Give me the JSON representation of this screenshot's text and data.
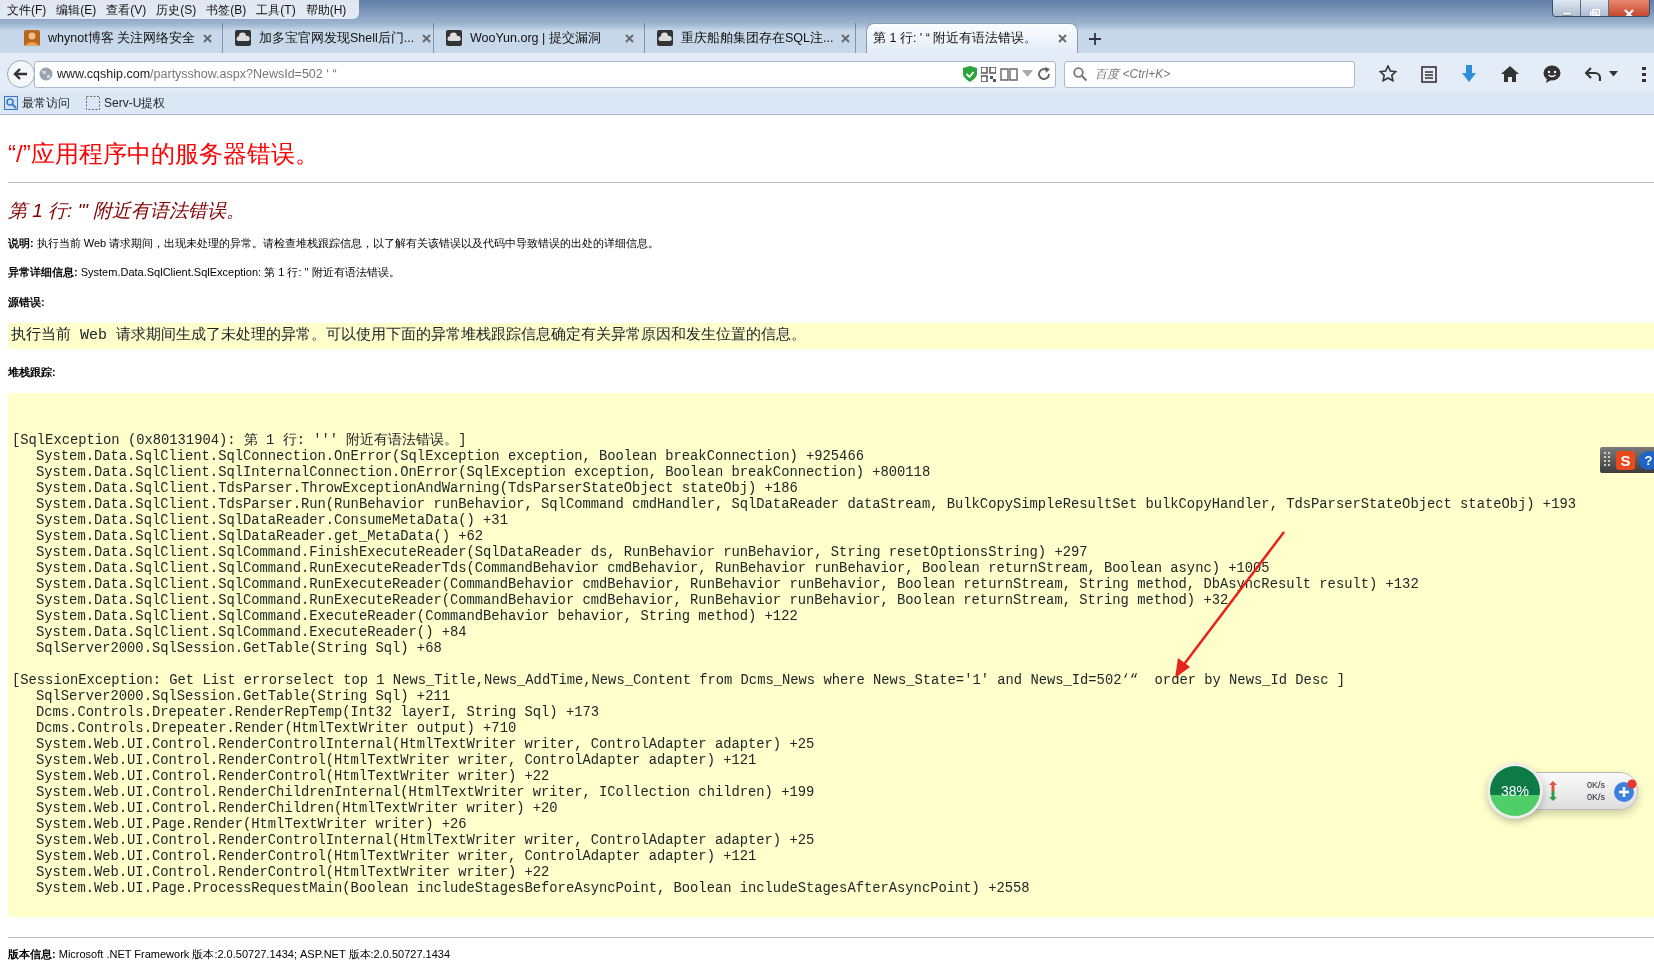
{
  "menu": [
    "文件(F)",
    "编辑(E)",
    "查看(V)",
    "历史(S)",
    "书签(B)",
    "工具(T)",
    "帮助(H)"
  ],
  "tabs": [
    {
      "label": "whynot博客 关注网络安全",
      "kind": "avatar",
      "selected": false
    },
    {
      "label": "加多宝官网发现Shell后门...",
      "kind": "cloud",
      "selected": false
    },
    {
      "label": "WooYun.org | 提交漏洞",
      "kind": "cloud",
      "selected": false
    },
    {
      "label": "重庆船舶集团存在SQL注...",
      "kind": "cloud",
      "selected": false
    },
    {
      "label": "第 1 行: '  “ 附近有语法错误。",
      "kind": "none",
      "selected": true
    }
  ],
  "address": {
    "host": "www.cqship.com",
    "path": "/partysshow.aspx?NewsId=502 ‘ “"
  },
  "search": {
    "placeholder": "百度 <Ctrl+K>"
  },
  "bookmarks": [
    {
      "label": "最常访问",
      "kind": "history"
    },
    {
      "label": "Serv-U提权",
      "kind": "blank"
    }
  ],
  "page": {
    "title": "“/”应用程序中的服务器错误。",
    "subtitle": "第 1 行: \"' 附近有语法错误。",
    "description": "**说明:** 执行当前 Web 请求期间，出现未处理的异常。请检查堆栈跟踪信息，以了解有关该错误以及代码中导致错误的出处的详细信息。",
    "exception_details": "**异常详细信息:** System.Data.SqlClient.SqlException: 第 1 行: '' 附近有语法错误。",
    "source_error_label": "源错误:",
    "source_error_text": "执行当前 Web 请求期间生成了未处理的异常。可以使用下面的异常堆栈跟踪信息确定有关异常原因和发生位置的信息。",
    "stack_trace_label": "堆栈跟踪:",
    "stack_trace": [
      {
        "kind": "header",
        "text": "[SqlException (0x80131904): 第 1 行: ''' 附近有语法错误。]"
      },
      {
        "kind": "frame",
        "text": "System.Data.SqlClient.SqlConnection.OnError(SqlException exception, Boolean breakConnection) +925466"
      },
      {
        "kind": "frame",
        "text": "System.Data.SqlClient.SqlInternalConnection.OnError(SqlException exception, Boolean breakConnection) +800118"
      },
      {
        "kind": "frame",
        "text": "System.Data.SqlClient.TdsParser.ThrowExceptionAndWarning(TdsParserStateObject stateObj) +186"
      },
      {
        "kind": "frame",
        "text": "System.Data.SqlClient.TdsParser.Run(RunBehavior runBehavior, SqlCommand cmdHandler, SqlDataReader dataStream, BulkCopySimpleResultSet bulkCopyHandler, TdsParserStateObject stateObj) +193"
      },
      {
        "kind": "frame",
        "text": "System.Data.SqlClient.SqlDataReader.ConsumeMetaData() +31"
      },
      {
        "kind": "frame",
        "text": "System.Data.SqlClient.SqlDataReader.get_MetaData() +62"
      },
      {
        "kind": "frame",
        "text": "System.Data.SqlClient.SqlCommand.FinishExecuteReader(SqlDataReader ds, RunBehavior runBehavior, String resetOptionsString) +297"
      },
      {
        "kind": "frame",
        "text": "System.Data.SqlClient.SqlCommand.RunExecuteReaderTds(CommandBehavior cmdBehavior, RunBehavior runBehavior, Boolean returnStream, Boolean async) +1005"
      },
      {
        "kind": "frame",
        "text": "System.Data.SqlClient.SqlCommand.RunExecuteReader(CommandBehavior cmdBehavior, RunBehavior runBehavior, Boolean returnStream, String method, DbAsyncResult result) +132"
      },
      {
        "kind": "frame",
        "text": "System.Data.SqlClient.SqlCommand.RunExecuteReader(CommandBehavior cmdBehavior, RunBehavior runBehavior, Boolean returnStream, String method) +32"
      },
      {
        "kind": "frame",
        "text": "System.Data.SqlClient.SqlCommand.ExecuteReader(CommandBehavior behavior, String method) +122"
      },
      {
        "kind": "frame",
        "text": "System.Data.SqlClient.SqlCommand.ExecuteReader() +84"
      },
      {
        "kind": "frame",
        "text": "SqlServer2000.SqlSession.GetTable(String Sql) +68"
      },
      {
        "kind": "blank"
      },
      {
        "kind": "header",
        "text": "[SessionException: Get List errorselect top 1 News_Title,News_AddTime,News_Content from Dcms_News where News_State='1' and News_Id=502‘“  order by News_Id Desc ]"
      },
      {
        "kind": "frame",
        "text": "SqlServer2000.SqlSession.GetTable(String Sql) +211"
      },
      {
        "kind": "frame",
        "text": "Dcms.Controls.Drepeater.RenderRepTemp(Int32 layerI, String Sql) +173"
      },
      {
        "kind": "frame",
        "text": "Dcms.Controls.Drepeater.Render(HtmlTextWriter output) +710"
      },
      {
        "kind": "frame",
        "text": "System.Web.UI.Control.RenderControlInternal(HtmlTextWriter writer, ControlAdapter adapter) +25"
      },
      {
        "kind": "frame",
        "text": "System.Web.UI.Control.RenderControl(HtmlTextWriter writer, ControlAdapter adapter) +121"
      },
      {
        "kind": "frame",
        "text": "System.Web.UI.Control.RenderControl(HtmlTextWriter writer) +22"
      },
      {
        "kind": "frame",
        "text": "System.Web.UI.Control.RenderChildrenInternal(HtmlTextWriter writer, ICollection children) +199"
      },
      {
        "kind": "frame",
        "text": "System.Web.UI.Control.RenderChildren(HtmlTextWriter writer) +20"
      },
      {
        "kind": "frame",
        "text": "System.Web.UI.Page.Render(HtmlTextWriter writer) +26"
      },
      {
        "kind": "frame",
        "text": "System.Web.UI.Control.RenderControlInternal(HtmlTextWriter writer, ControlAdapter adapter) +25"
      },
      {
        "kind": "frame",
        "text": "System.Web.UI.Control.RenderControl(HtmlTextWriter writer, ControlAdapter adapter) +121"
      },
      {
        "kind": "frame",
        "text": "System.Web.UI.Control.RenderControl(HtmlTextWriter writer) +22"
      },
      {
        "kind": "frame",
        "text": "System.Web.UI.Page.ProcessRequestMain(Boolean includeStagesBeforeAsyncPoint, Boolean includeStagesAfterAsyncPoint) +2558"
      }
    ],
    "version": "**版本信息:** Microsoft .NET Framework 版本:2.0.50727.1434; ASP.NET 版本:2.0.50727.1434"
  },
  "ime_toolbar": {
    "logo": "S",
    "help": "?"
  },
  "speed_widget": {
    "reading": "38%",
    "upload": "0K/s",
    "download": "0K/s"
  }
}
